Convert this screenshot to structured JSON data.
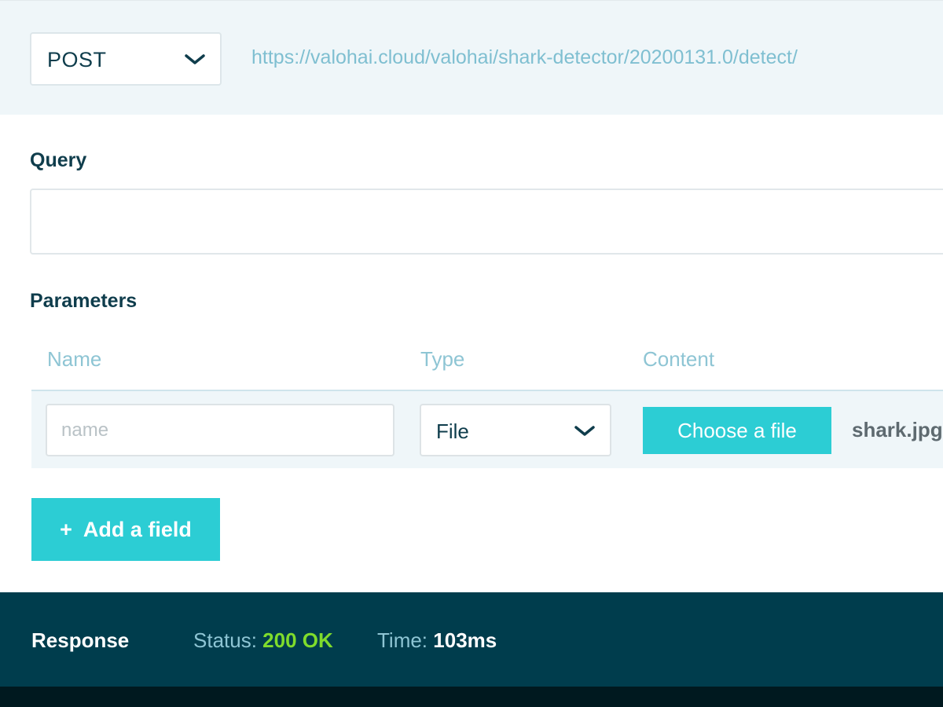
{
  "request": {
    "method": "POST",
    "url": "https://valohai.cloud/valohai/shark-detector/20200131.0/detect/"
  },
  "query": {
    "label": "Query",
    "value": ""
  },
  "parameters": {
    "label": "Parameters",
    "columns": [
      "Name",
      "Type",
      "Content"
    ],
    "rows": [
      {
        "name_placeholder": "name",
        "name_value": "",
        "type": "File",
        "choose_label": "Choose a file",
        "file_name": "shark.jpg"
      }
    ],
    "add_plus": "+",
    "add_label": "Add a field"
  },
  "response": {
    "title": "Response",
    "status_label": "Status:",
    "status_value": "200 OK",
    "time_label": "Time:",
    "time_value": "103ms"
  },
  "colors": {
    "accent": "#2ccdd4",
    "dark": "#003d4d",
    "status_ok": "#7fdc2c",
    "link": "#7fbfd1"
  },
  "icons": [
    "chevron-down-icon",
    "plus-icon"
  ]
}
